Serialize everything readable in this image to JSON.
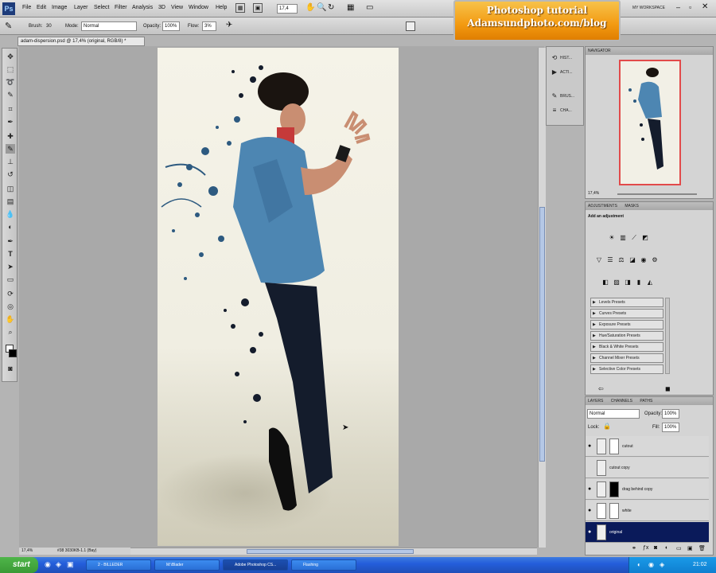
{
  "menu": {
    "logo": "Ps",
    "items": [
      "File",
      "Edit",
      "Image",
      "Layer",
      "Select",
      "Filter",
      "Analysis",
      "3D",
      "View",
      "Window",
      "Help"
    ],
    "zoom": "17,4",
    "workspace": "MY WORKSPACE"
  },
  "options": {
    "brush_label": "Brush:",
    "brush_size": "30",
    "mode_label": "Mode:",
    "mode_value": "Normal",
    "opacity_label": "Opacity:",
    "opacity_value": "100%",
    "flow_label": "Flow:",
    "flow_value": "3%"
  },
  "banner": {
    "line1": "Photoshop tutorial",
    "line2": "Adamsundphoto.com/blog"
  },
  "document": {
    "tab": "adam-dispersion.psd @ 17,4% (original, RGB/8) *",
    "status_zoom": "17,4%",
    "status_doc": "#38 3030KB-1.1 (Bay)"
  },
  "dock_buttons": [
    "HIST...",
    "ACTI...",
    "BRUS...",
    "CHA..."
  ],
  "navigator": {
    "title": "NAVIGATOR",
    "zoom": "17,4%"
  },
  "adjustments": {
    "tabs": [
      "ADJUSTMENTS",
      "MASKS"
    ],
    "hint": "Add an adjustment",
    "presets": [
      "Levels Presets",
      "Curves Presets",
      "Exposure Presets",
      "Hue/Saturation Presets",
      "Black & White Presets",
      "Channel Mixer Presets",
      "Selective Color Presets"
    ]
  },
  "layers": {
    "tabs": [
      "LAYERS",
      "CHANNELS",
      "PATHS"
    ],
    "blend_mode": "Normal",
    "opacity_label": "Opacity:",
    "opacity_value": "100%",
    "lock_label": "Lock:",
    "fill_label": "Fill:",
    "fill_value": "100%",
    "items": [
      "cutout",
      "cutout copy",
      "drag behind copy",
      "white",
      "original"
    ]
  },
  "taskbar": {
    "start": "start",
    "tasks": [
      "2 - BILLEDER",
      "M:\\Blader",
      "Adobe Photoshop CS...",
      "Flashing"
    ],
    "clock": "21:02"
  },
  "colors": {
    "accent": "#f39a11",
    "selected_layer": "#0a1a5a",
    "taskbar": "#245edb"
  }
}
